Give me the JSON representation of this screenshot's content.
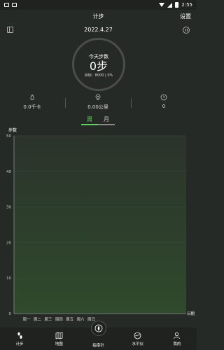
{
  "status_bar": {
    "time": "2:55"
  },
  "header": {
    "title": "计步",
    "settings": "设置"
  },
  "date": "2022.4.27",
  "today": {
    "label": "今天步数",
    "steps": "0步",
    "goal": "目标：8000 | 0%"
  },
  "stats": [
    {
      "icon": "flame-icon",
      "value": "0.0千卡"
    },
    {
      "icon": "location-pin-icon",
      "value": "0.00公里"
    },
    {
      "icon": "clock-icon",
      "value": "0"
    }
  ],
  "tabs": [
    {
      "label": "周",
      "active": true
    },
    {
      "label": "月",
      "active": false
    }
  ],
  "chart_data": {
    "type": "bar",
    "ylabel": "步数",
    "xlabel": "日期",
    "ylim": [
      0,
      50
    ],
    "yticks": [
      "0",
      "10",
      "20",
      "30",
      "40",
      "50"
    ],
    "categories": [
      "周一",
      "周二",
      "周三",
      "周四",
      "周五",
      "周六",
      "周日"
    ],
    "values": [
      0,
      0,
      0,
      0,
      0,
      0,
      0
    ],
    "grid": true
  },
  "bottom_nav": [
    {
      "icon": "steps-icon",
      "label": "计步",
      "active": true
    },
    {
      "icon": "map-icon",
      "label": "地图"
    },
    {
      "icon": "compass-icon",
      "label": "指南针"
    },
    {
      "icon": "level-icon",
      "label": "水平仪"
    },
    {
      "icon": "user-icon",
      "label": "我的"
    }
  ],
  "colors": {
    "accent": "#5fd35f",
    "background": "#262a26"
  }
}
